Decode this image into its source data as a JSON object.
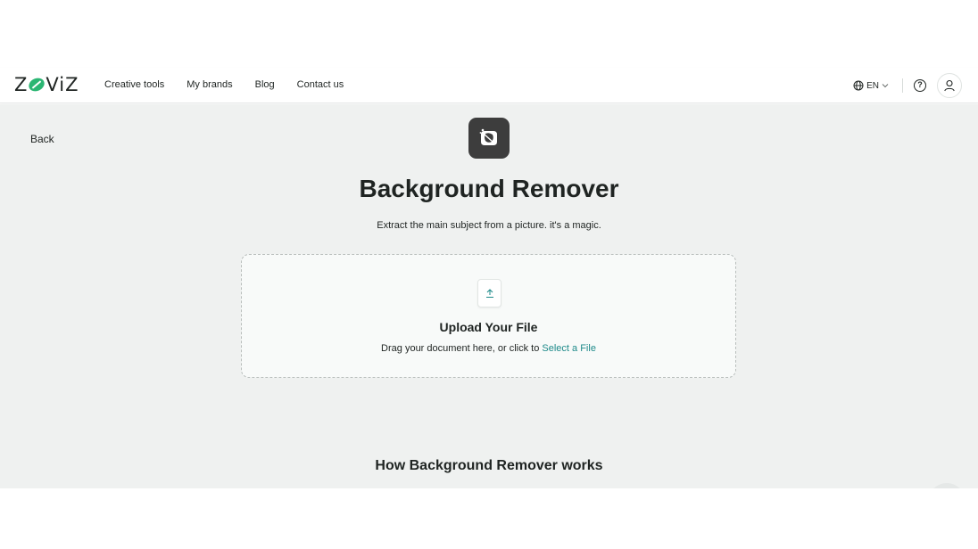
{
  "brand": {
    "logo_left": "Z",
    "logo_right": "ViZ"
  },
  "nav": {
    "links": [
      "Creative tools",
      "My brands",
      "Blog",
      "Contact us"
    ],
    "language": "EN",
    "help_symbol": "?"
  },
  "page": {
    "back_label": "Back",
    "title": "Background Remover",
    "subtitle": "Extract the main subject from a picture. it's a magic.",
    "section_title": "How Background Remover works"
  },
  "upload": {
    "title": "Upload Your File",
    "description": "Drag your document here, or click to ",
    "link_label": "Select a File"
  },
  "colors": {
    "accent": "#1e8a8a",
    "brand_green": "#2bb673",
    "background": "#eff1f0",
    "tool_icon_bg": "#3d3d3d"
  },
  "icons": [
    "globe-icon",
    "chevron-down-icon",
    "help-icon",
    "user-icon",
    "background-remover-icon",
    "file-upload-icon"
  ]
}
